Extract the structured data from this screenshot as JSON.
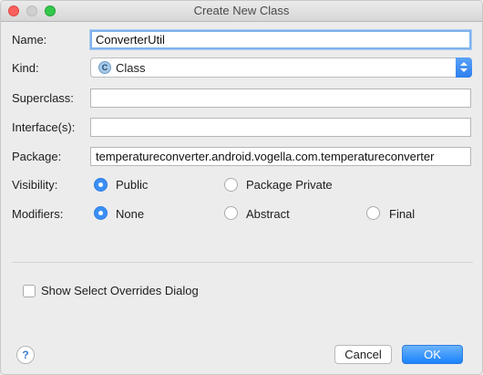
{
  "window": {
    "title": "Create New Class"
  },
  "form": {
    "name_label": "Name:",
    "name_value": "ConverterUtil",
    "kind_label": "Kind:",
    "kind_value": "Class",
    "kind_icon_letter": "C",
    "superclass_label": "Superclass:",
    "superclass_value": "",
    "interfaces_label": "Interface(s):",
    "interfaces_value": "",
    "package_label": "Package:",
    "package_value": "temperatureconverter.android.vogella.com.temperatureconverter"
  },
  "visibility": {
    "label": "Visibility:",
    "options": [
      {
        "label": "Public",
        "selected": true
      },
      {
        "label": "Package Private",
        "selected": false
      }
    ]
  },
  "modifiers": {
    "label": "Modifiers:",
    "options": [
      {
        "label": "None",
        "selected": true
      },
      {
        "label": "Abstract",
        "selected": false
      },
      {
        "label": "Final",
        "selected": false
      }
    ]
  },
  "overrides": {
    "label": "Show Select Overrides Dialog",
    "checked": false
  },
  "buttons": {
    "help": "?",
    "cancel": "Cancel",
    "ok": "OK"
  },
  "colors": {
    "accent": "#3a8ef5",
    "ok_button": "#1a82fb"
  }
}
